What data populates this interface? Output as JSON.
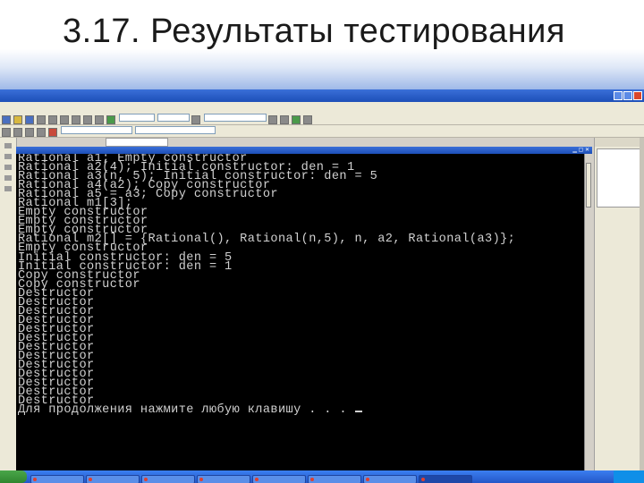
{
  "slide": {
    "title": "3.17. Результаты тестирования"
  },
  "console": {
    "lines": [
      "Rational a1; Empty constructor",
      "Rational a2(4); Initial constructor: den = 1",
      "Rational a3(n, 5); Initial constructor: den = 5",
      "Rational a4(a2); Copy constructor",
      "Rational a5 = a3; Copy constructor",
      "Rational m1[3];",
      "Empty constructor",
      "Empty constructor",
      "Empty constructor",
      "Rational m2[] = {Rational(), Rational(n,5), n, a2, Rational(a3)};",
      "Empty constructor",
      "Initial constructor: den = 5",
      "Initial constructor: den = 1",
      "Copy constructor",
      "Copy constructor",
      "Destructor",
      "Destructor",
      "Destructor",
      "Destructor",
      "Destructor",
      "Destructor",
      "Destructor",
      "Destructor",
      "Destructor",
      "Destructor",
      "Destructor",
      "Destructor",
      "Destructor",
      "Для продолжения нажмите любую клавишу . . . "
    ]
  },
  "colors": {
    "console_bg": "#000000",
    "console_text": "#d0d0d0",
    "titlebar_blue": "#1d4fb8",
    "taskbar_blue": "#2457c8"
  }
}
